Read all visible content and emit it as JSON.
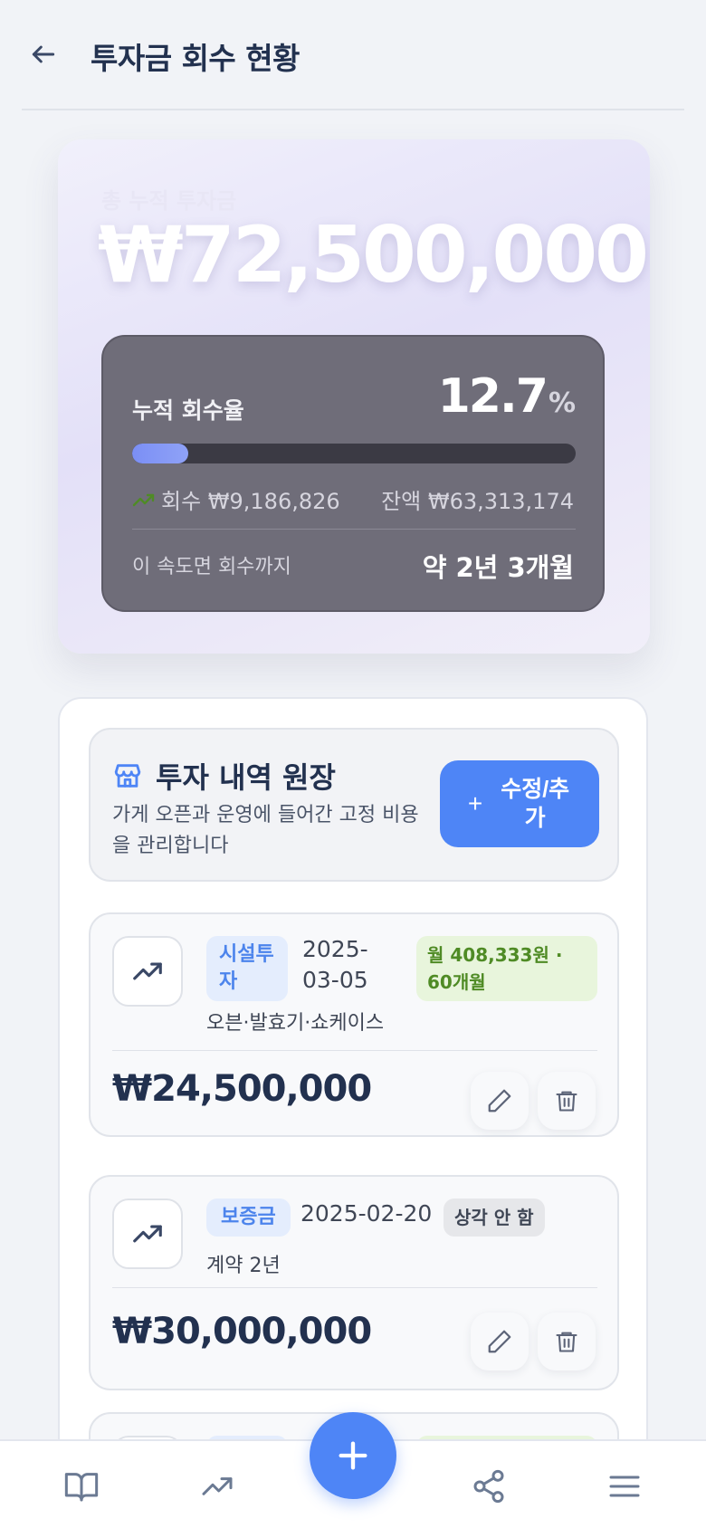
{
  "header": {
    "title": "투자금 회수 현황",
    "back_icon": "arrow-left-icon"
  },
  "hero": {
    "label": "총 누적 투자금",
    "amount": "₩72,500,000",
    "recovery": {
      "label": "누적 회수율",
      "rate": "12.7",
      "rate_unit": "%",
      "progress_fraction": 0.127,
      "recovered_text": "회수 ₩9,186,826",
      "remaining_text": "잔액 ₩63,313,174",
      "eta_label": "이 속도면 회수까지",
      "eta_value": "약 2년 3개월"
    }
  },
  "ledger": {
    "title": "투자 내역 원장",
    "description": "가게 오픈과 운영에 들어간 고정 비용을 관리합니다",
    "edit_button": "수정/추가",
    "entries": [
      {
        "category": "시설투자",
        "date": "2025-03-05",
        "badge": "월 408,333원 · 60개월",
        "badge_type": "green",
        "note": "오븐·발효기·쇼케이스",
        "amount": "₩24,500,000"
      },
      {
        "category": "보증금",
        "date": "2025-02-20",
        "badge": "상각 안 함",
        "badge_type": "gray",
        "note": "계약 2년",
        "amount": "₩30,000,000"
      }
    ]
  },
  "colors": {
    "accent": "#4e85f6",
    "progress": "#7b8ff5",
    "positive": "#4f8b25"
  },
  "nav": {
    "items": [
      "book-icon",
      "trend-icon",
      "add-icon",
      "share-icon",
      "menu-icon"
    ]
  }
}
